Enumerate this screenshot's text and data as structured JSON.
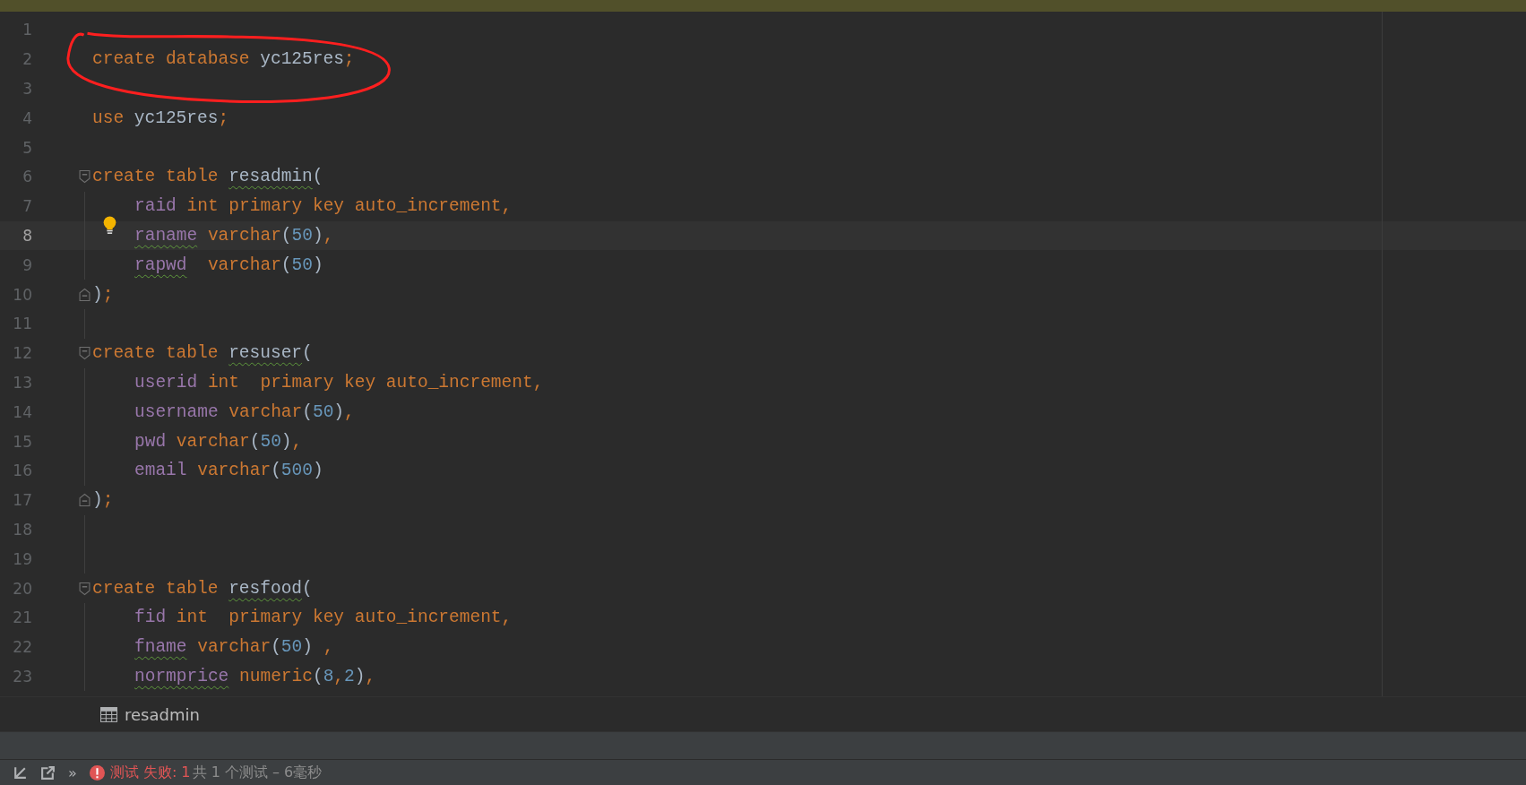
{
  "editor": {
    "lines": [
      {
        "number": "1",
        "kind": "code",
        "current": false
      },
      {
        "number": "2",
        "kind": "code",
        "current": false,
        "indented": false,
        "tokens": [
          {
            "kind": "kw",
            "text": "create database "
          },
          {
            "kind": "name",
            "text": "yc125res"
          },
          {
            "kind": "kw",
            "text": ";"
          }
        ]
      },
      {
        "number": "3",
        "kind": "code",
        "current": false
      },
      {
        "number": "4",
        "kind": "code",
        "current": false,
        "indented": false,
        "tokens": [
          {
            "kind": "kw",
            "text": "use "
          },
          {
            "kind": "name",
            "text": "yc125res"
          },
          {
            "kind": "kw",
            "text": ";"
          }
        ]
      },
      {
        "number": "5",
        "kind": "code",
        "current": false
      },
      {
        "number": "6",
        "kind": "fold-start",
        "current": false,
        "indented": false,
        "tokens": [
          {
            "kind": "kw",
            "text": "create table "
          },
          {
            "kind": "name-typo",
            "text": "resadmin"
          },
          {
            "kind": "plain",
            "text": "("
          }
        ]
      },
      {
        "number": "7",
        "kind": "code",
        "current": false,
        "indented": true,
        "tokens": [
          {
            "kind": "col",
            "text": "raid"
          },
          {
            "kind": "kw",
            "text": " int primary key auto_increment,"
          }
        ]
      },
      {
        "number": "8",
        "kind": "code",
        "current": true,
        "indented": true,
        "intention": true,
        "tokens": [
          {
            "kind": "col-typo",
            "text": "raname"
          },
          {
            "kind": "kw",
            "text": " varchar"
          },
          {
            "kind": "plain",
            "text": "("
          },
          {
            "kind": "num",
            "text": "50"
          },
          {
            "kind": "plain",
            "text": ")"
          },
          {
            "kind": "kw",
            "text": ","
          }
        ]
      },
      {
        "number": "9",
        "kind": "code",
        "current": false,
        "indented": true,
        "tokens": [
          {
            "kind": "col-typo",
            "text": "rapwd"
          },
          {
            "kind": "kw",
            "text": "  varchar"
          },
          {
            "kind": "plain",
            "text": "("
          },
          {
            "kind": "num",
            "text": "50"
          },
          {
            "kind": "plain",
            "text": ")"
          }
        ]
      },
      {
        "number": "10",
        "kind": "fold-end",
        "current": false,
        "indented": false,
        "tokens": [
          {
            "kind": "plain",
            "text": ")"
          },
          {
            "kind": "kw",
            "text": ";"
          }
        ]
      },
      {
        "number": "11",
        "kind": "code",
        "current": false
      },
      {
        "number": "12",
        "kind": "fold-start",
        "current": false,
        "indented": false,
        "tokens": [
          {
            "kind": "kw",
            "text": "create table "
          },
          {
            "kind": "name-typo",
            "text": "resuser"
          },
          {
            "kind": "plain",
            "text": "("
          }
        ]
      },
      {
        "number": "13",
        "kind": "code",
        "current": false,
        "indented": true,
        "tokens": [
          {
            "kind": "col",
            "text": "userid"
          },
          {
            "kind": "kw",
            "text": " int  primary key auto_increment,"
          }
        ]
      },
      {
        "number": "14",
        "kind": "code",
        "current": false,
        "indented": true,
        "tokens": [
          {
            "kind": "col",
            "text": "username"
          },
          {
            "kind": "kw",
            "text": " varchar"
          },
          {
            "kind": "plain",
            "text": "("
          },
          {
            "kind": "num",
            "text": "50"
          },
          {
            "kind": "plain",
            "text": ")"
          },
          {
            "kind": "kw",
            "text": ","
          }
        ]
      },
      {
        "number": "15",
        "kind": "code",
        "current": false,
        "indented": true,
        "tokens": [
          {
            "kind": "col",
            "text": "pwd"
          },
          {
            "kind": "kw",
            "text": " varchar"
          },
          {
            "kind": "plain",
            "text": "("
          },
          {
            "kind": "num",
            "text": "50"
          },
          {
            "kind": "plain",
            "text": ")"
          },
          {
            "kind": "kw",
            "text": ","
          }
        ]
      },
      {
        "number": "16",
        "kind": "code",
        "current": false,
        "indented": true,
        "tokens": [
          {
            "kind": "col",
            "text": "email"
          },
          {
            "kind": "kw",
            "text": " varchar"
          },
          {
            "kind": "plain",
            "text": "("
          },
          {
            "kind": "num",
            "text": "500"
          },
          {
            "kind": "plain",
            "text": ")"
          }
        ]
      },
      {
        "number": "17",
        "kind": "fold-end",
        "current": false,
        "indented": false,
        "tokens": [
          {
            "kind": "plain",
            "text": ")"
          },
          {
            "kind": "kw",
            "text": ";"
          }
        ]
      },
      {
        "number": "18",
        "kind": "code",
        "current": false
      },
      {
        "number": "19",
        "kind": "code",
        "current": false
      },
      {
        "number": "20",
        "kind": "fold-start",
        "current": false,
        "indented": false,
        "tokens": [
          {
            "kind": "kw",
            "text": "create table "
          },
          {
            "kind": "name-typo",
            "text": "resfood"
          },
          {
            "kind": "plain",
            "text": "("
          }
        ]
      },
      {
        "number": "21",
        "kind": "code",
        "current": false,
        "indented": true,
        "tokens": [
          {
            "kind": "col",
            "text": "fid"
          },
          {
            "kind": "kw",
            "text": " int  primary key auto_increment,"
          }
        ]
      },
      {
        "number": "22",
        "kind": "code",
        "current": false,
        "indented": true,
        "tokens": [
          {
            "kind": "col-typo",
            "text": "fname"
          },
          {
            "kind": "kw",
            "text": " varchar"
          },
          {
            "kind": "plain",
            "text": "("
          },
          {
            "kind": "num",
            "text": "50"
          },
          {
            "kind": "plain",
            "text": ")"
          },
          {
            "kind": "kw",
            "text": " ,"
          }
        ]
      },
      {
        "number": "23",
        "kind": "code",
        "current": false,
        "indented": true,
        "tokens": [
          {
            "kind": "col-typo",
            "text": "normprice"
          },
          {
            "kind": "kw",
            "text": " numeric"
          },
          {
            "kind": "plain",
            "text": "("
          },
          {
            "kind": "num",
            "text": "8"
          },
          {
            "kind": "kw",
            "text": ","
          },
          {
            "kind": "num",
            "text": "2"
          },
          {
            "kind": "plain",
            "text": ")"
          },
          {
            "kind": "kw",
            "text": ","
          }
        ]
      }
    ]
  },
  "breadcrumb": {
    "label": "resadmin"
  },
  "status_bar": {
    "more": "»",
    "error_label": "测试 失败: 1",
    "summary": "共 1 个测试 – 6毫秒"
  }
}
